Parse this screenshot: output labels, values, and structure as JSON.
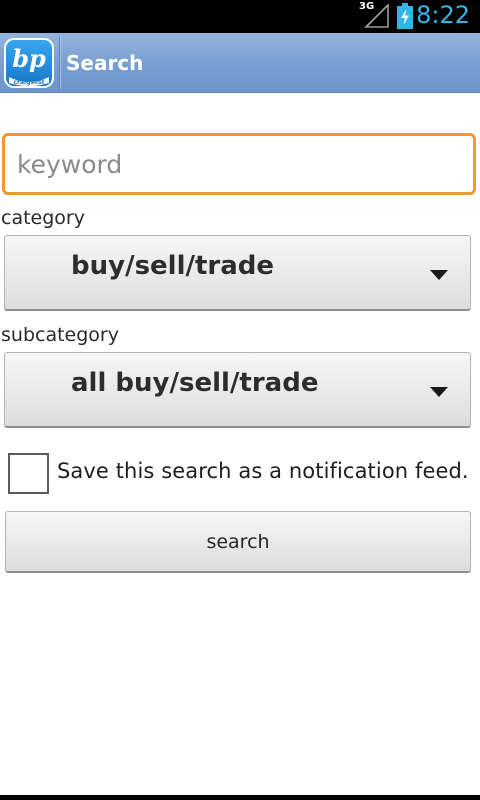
{
  "status_bar": {
    "network_type": "3G",
    "time": "8:22",
    "signal_icon": "signal-strength-icon",
    "battery_icon": "battery-charging-icon"
  },
  "action_bar": {
    "logo_text": "bp",
    "logo_subtext": "craigslist",
    "title": "Search"
  },
  "search_form": {
    "keyword": {
      "value": "",
      "placeholder": "keyword"
    },
    "category_label": "category",
    "category_selected": "buy/sell/trade",
    "subcategory_label": "subcategory",
    "subcategory_selected": "all buy/sell/trade",
    "save_notification_label": "Save this search as a notification feed.",
    "save_notification_checked": false,
    "search_button_label": "search"
  },
  "colors": {
    "status_clock": "#33b5e5",
    "action_bar": "#7aa0d2",
    "input_focus_border": "#ee9a32",
    "logo_blue": "#1f8fde"
  }
}
